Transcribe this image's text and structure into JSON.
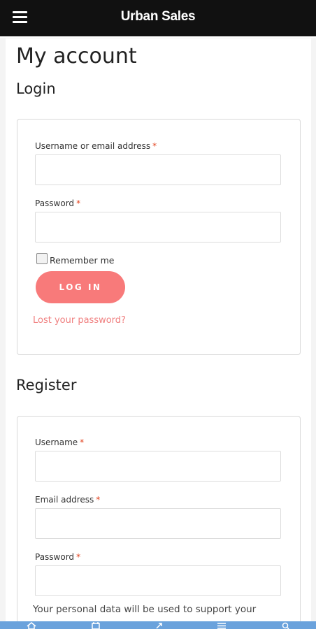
{
  "app": {
    "title": "Urban Sales",
    "menu_icon": "hamburger-menu-icon"
  },
  "page": {
    "title": "My account"
  },
  "login": {
    "heading": "Login",
    "username_label": "Username or email address",
    "password_label": "Password",
    "required_mark": "*",
    "remember_label": "Remember me",
    "remember_checked": false,
    "button_label": "LOG IN",
    "lost_password_link": "Lost your password?"
  },
  "register": {
    "heading": "Register",
    "username_label": "Username",
    "email_label": "Email address",
    "password_label": "Password",
    "required_mark": "*",
    "privacy_text": "Your personal data will be used to support your"
  },
  "bottom_nav": {
    "icons": [
      "home-icon",
      "calendar-icon",
      "share-icon",
      "list-icon",
      "search-icon"
    ]
  },
  "colors": {
    "topbar": "#111111",
    "accent": "#f87a7a",
    "link": "#f07f7f",
    "required": "#e2401c",
    "bottom_nav": "#6aa2dc"
  }
}
